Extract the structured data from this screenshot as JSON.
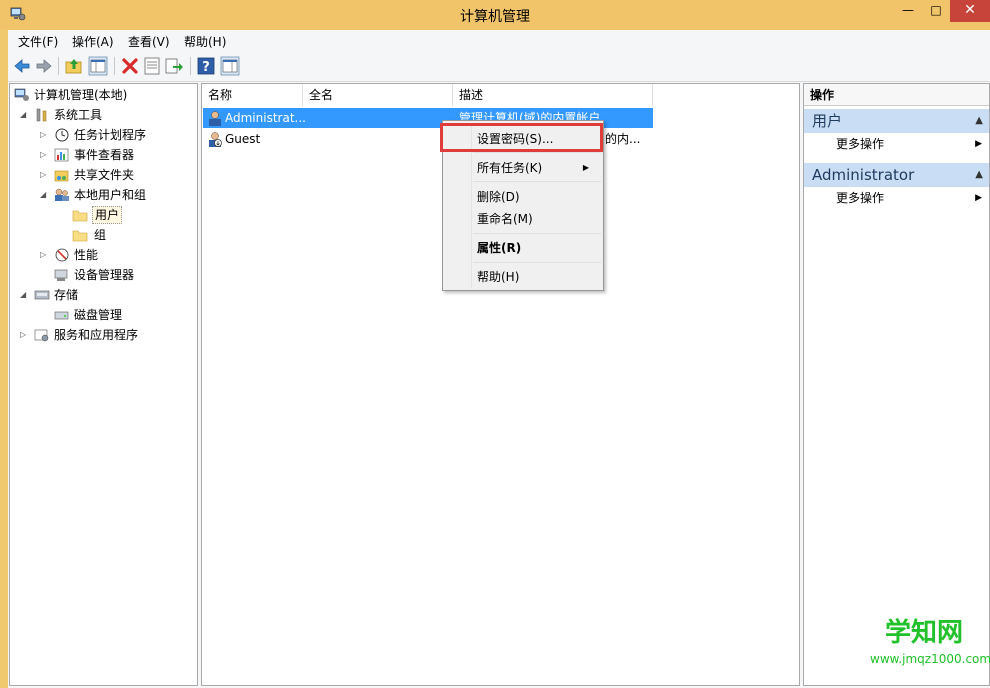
{
  "window": {
    "title": "计算机管理",
    "minimize_glyph": "—",
    "maximize_glyph": "□",
    "close_glyph": "✕"
  },
  "menubar": {
    "items": [
      "文件(F)",
      "操作(A)",
      "查看(V)",
      "帮助(H)"
    ]
  },
  "toolbar": {
    "buttons": [
      "back-icon",
      "forward-icon",
      "up-folder-icon",
      "show-hide-tree-icon",
      "delete-icon",
      "properties-icon",
      "export-icon",
      "help-icon",
      "show-hide-action-icon"
    ]
  },
  "tree": {
    "root": "计算机管理(本地)",
    "items": [
      {
        "label": "系统工具"
      },
      {
        "label": "任务计划程序"
      },
      {
        "label": "事件查看器"
      },
      {
        "label": "共享文件夹"
      },
      {
        "label": "本地用户和组"
      },
      {
        "label": "用户"
      },
      {
        "label": "组"
      },
      {
        "label": "性能"
      },
      {
        "label": "设备管理器"
      },
      {
        "label": "存储"
      },
      {
        "label": "磁盘管理"
      },
      {
        "label": "服务和应用程序"
      }
    ]
  },
  "list": {
    "columns": [
      "名称",
      "全名",
      "描述"
    ],
    "rows": [
      {
        "name": "Administrat...",
        "fullname": "",
        "desc": "管理计算机(域)的内置帐户"
      },
      {
        "name": "Guest",
        "fullname": "",
        "desc": "的内..."
      }
    ]
  },
  "context_menu": {
    "items": [
      "设置密码(S)...",
      "所有任务(K)",
      "删除(D)",
      "重命名(M)",
      "属性(R)",
      "帮助(H)"
    ]
  },
  "actions": {
    "header": "操作",
    "sections": [
      {
        "title": "用户",
        "link": "更多操作"
      },
      {
        "title": "Administrator",
        "link": "更多操作"
      }
    ]
  },
  "watermark": {
    "cn": "学知网",
    "en": "www.jmqz1000.com"
  },
  "colors": {
    "titlebar": "#f1c469",
    "selection": "#3399ff",
    "highlight": "#e03c3c",
    "action_section": "#c9def5"
  }
}
